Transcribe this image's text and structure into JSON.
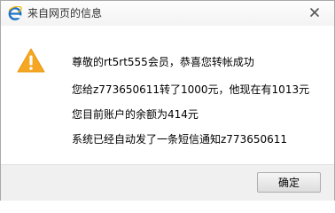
{
  "dialog": {
    "title": "来自网页的信息",
    "title_icon": "ie-browser-icon",
    "close_icon": "close-icon",
    "warning_icon": "warning-triangle-icon",
    "messages": [
      "尊敬的rt5rt555会员，恭喜您转帐成功",
      "您给z773650611转了1000元，他现在有1013元",
      "您目前账户的余额为414元",
      "系统已经自动发了一条短信通知z773650611"
    ],
    "ok_label": "确定"
  },
  "colors": {
    "warning": "#f5a623",
    "ie_blue": "#1e73c8",
    "footer_bg": "#f0f0f0"
  }
}
